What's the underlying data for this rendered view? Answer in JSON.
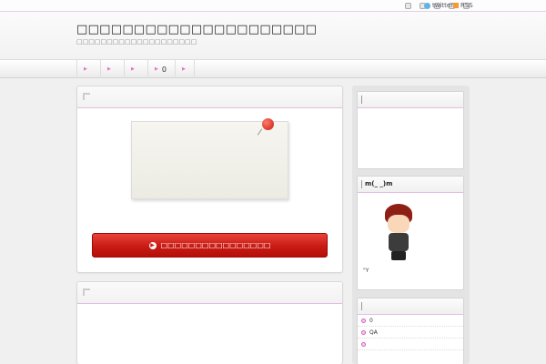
{
  "topbar": {
    "twitter_label": "twitter",
    "rss_label": "RSS"
  },
  "header": {
    "title": "□□□□□□□□□□□□□□□□□□□□□",
    "description": "□□□□□□□□□□□□□□□□□□□□"
  },
  "nav": {
    "items": [
      {
        "label": ""
      },
      {
        "label": ""
      },
      {
        "label": ""
      },
      {
        "label": "0"
      },
      {
        "label": ""
      }
    ]
  },
  "main": {
    "button_label": "□□□□□□□□□□□□□□□□"
  },
  "sidebar": {
    "widget1_title": "",
    "widget2_title": "m(_ _)m",
    "widget2_caption": "\"Y",
    "widget3_title": "",
    "widget3_items": [
      "0",
      "QA",
      ""
    ]
  },
  "colors": {
    "accent_pink": "#e06fd0",
    "button_red": "#c81b13"
  }
}
